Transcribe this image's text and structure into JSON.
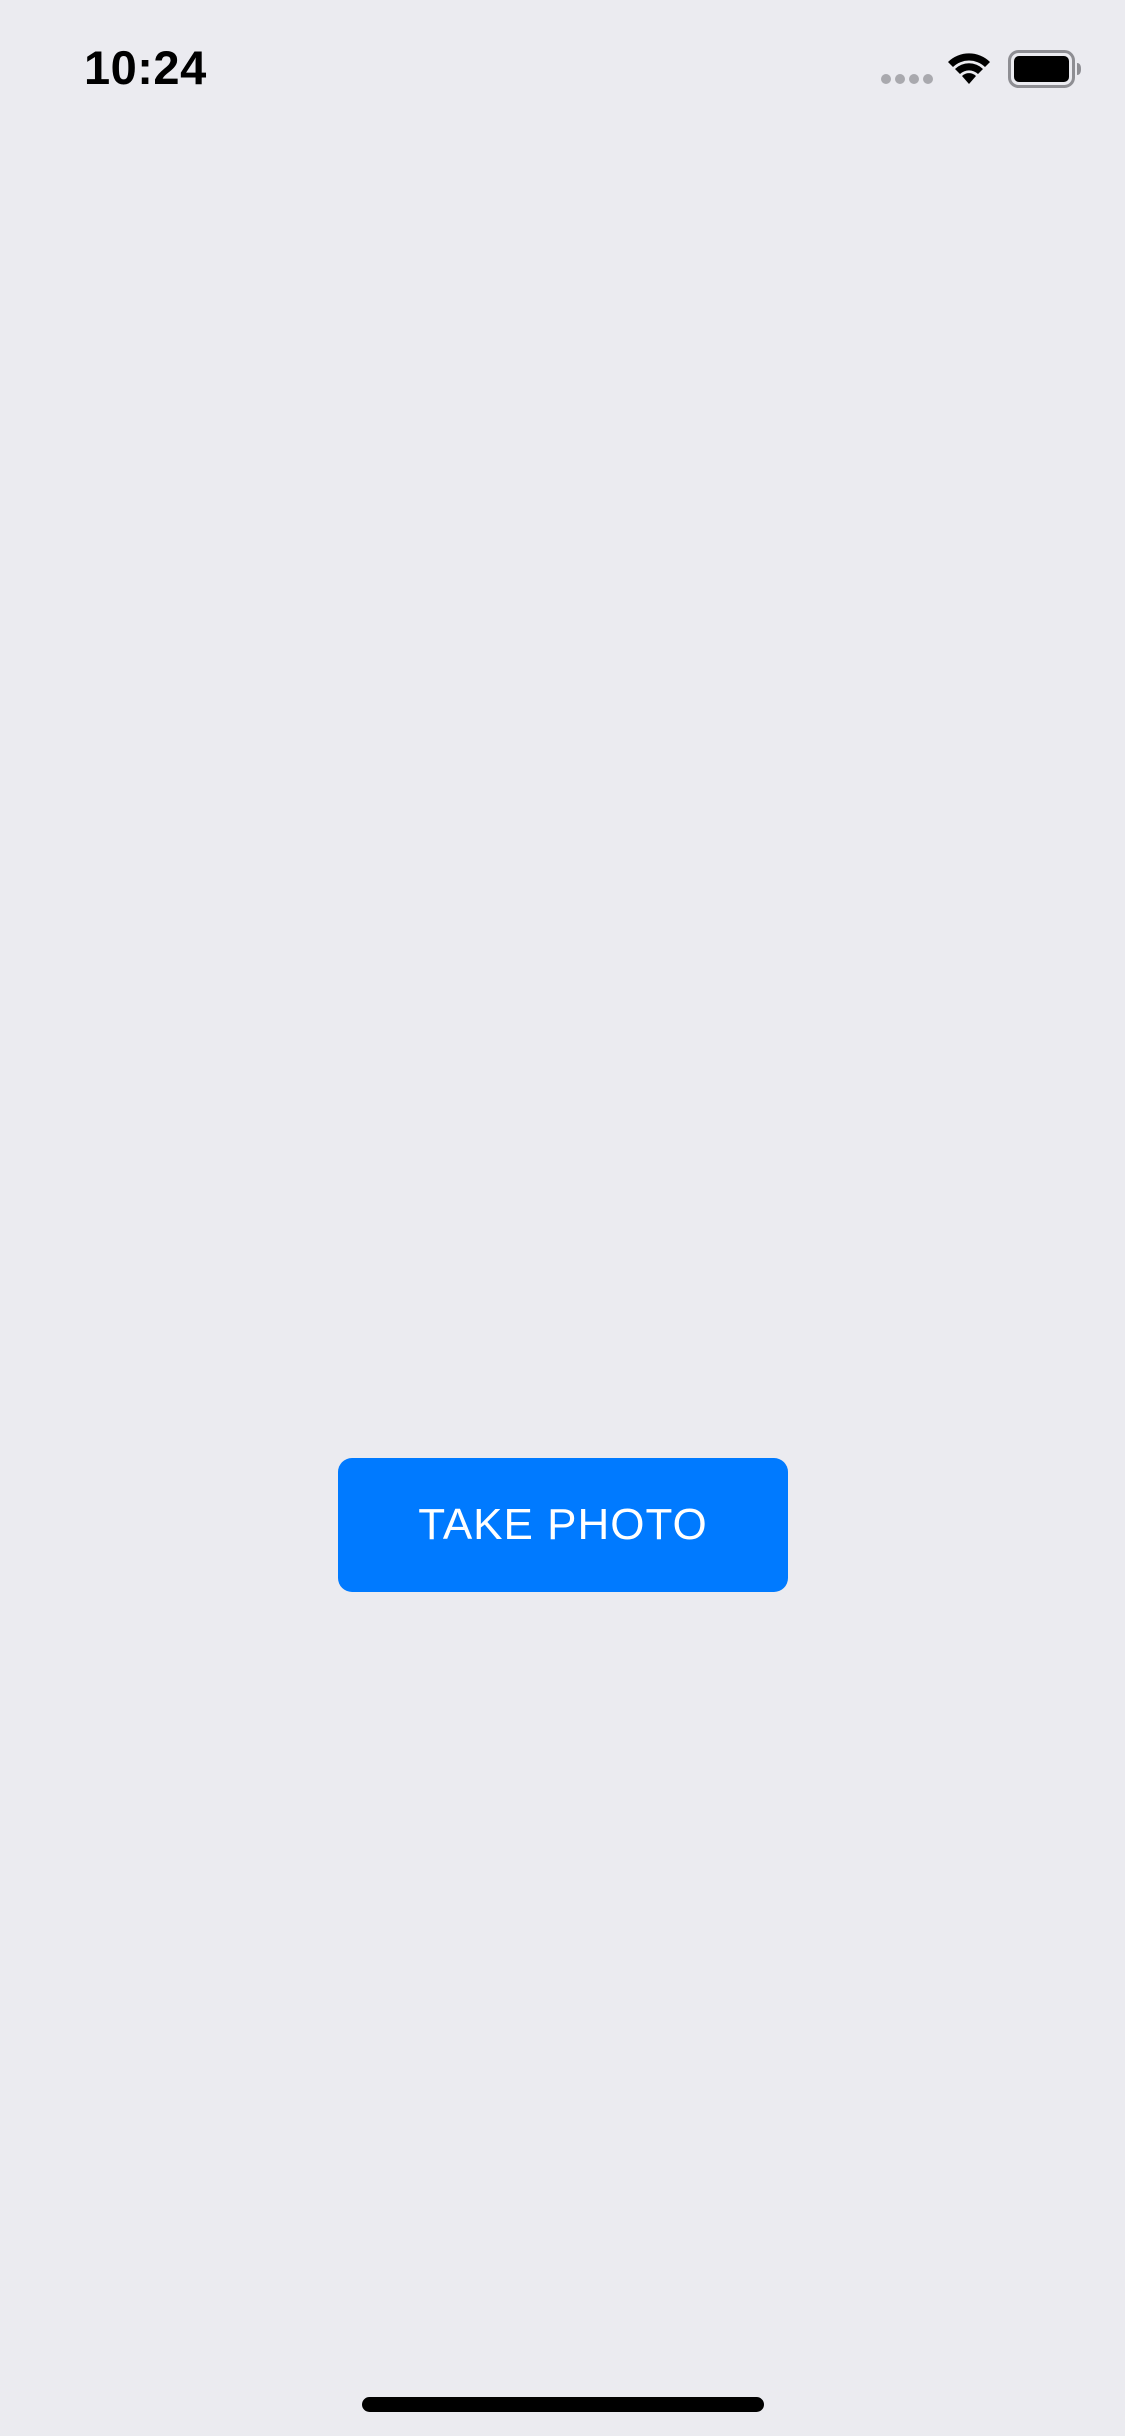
{
  "status_bar": {
    "time": "10:24",
    "icons": [
      "signal-dots-icon",
      "wifi-icon",
      "battery-icon"
    ]
  },
  "main": {
    "button_label": "TAKE PHOTO"
  },
  "colors": {
    "background": "#EBEBF0",
    "accent": "#007AFF",
    "button_text": "#FFFFFF",
    "status_text": "#000000"
  }
}
